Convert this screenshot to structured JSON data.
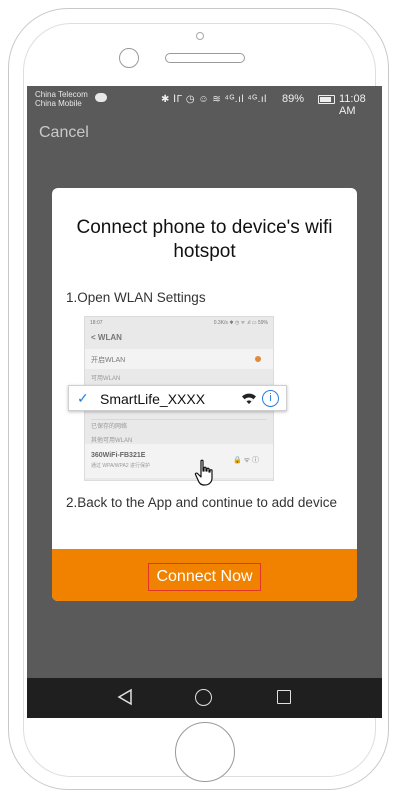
{
  "statusbar": {
    "carrier_line1": "China Telecom",
    "carrier_line2": "China Mobile",
    "icons": "✱ ⅠΓ ◷ ☺ ≋ ⁴ᴳ.ıl ⁴ᴳ.ıl",
    "battery": "89%",
    "time": "11:08 AM"
  },
  "header": {
    "cancel_label": "Cancel"
  },
  "dialog": {
    "title": "Connect phone to device's wifi hotspot",
    "step1": "1.Open WLAN Settings",
    "step2": "2.Back to the App and continue to add device",
    "connect_label": "Connect Now"
  },
  "settings_preview": {
    "status_left": "18:07",
    "status_right": "0.3K/s ✱ ◷ ᯤ .ıl ▭ 59%",
    "title": "< WLAN",
    "enable_label": "开启WLAN",
    "available_label": "可用WLAN",
    "saved_label": "已保存的网络",
    "other_label": "其他可用WLAN",
    "bottom_network_name": "360WiFi-FB321E",
    "bottom_network_sub": "通过 WPA/WPA2 进行保护"
  },
  "network": {
    "ssid": "SmartLife_XXXX",
    "info_glyph": "i",
    "check_glyph": "✓"
  },
  "colors": {
    "accent": "#f08200",
    "highlight_border": "#e0352b",
    "link_blue": "#2a7de1"
  }
}
